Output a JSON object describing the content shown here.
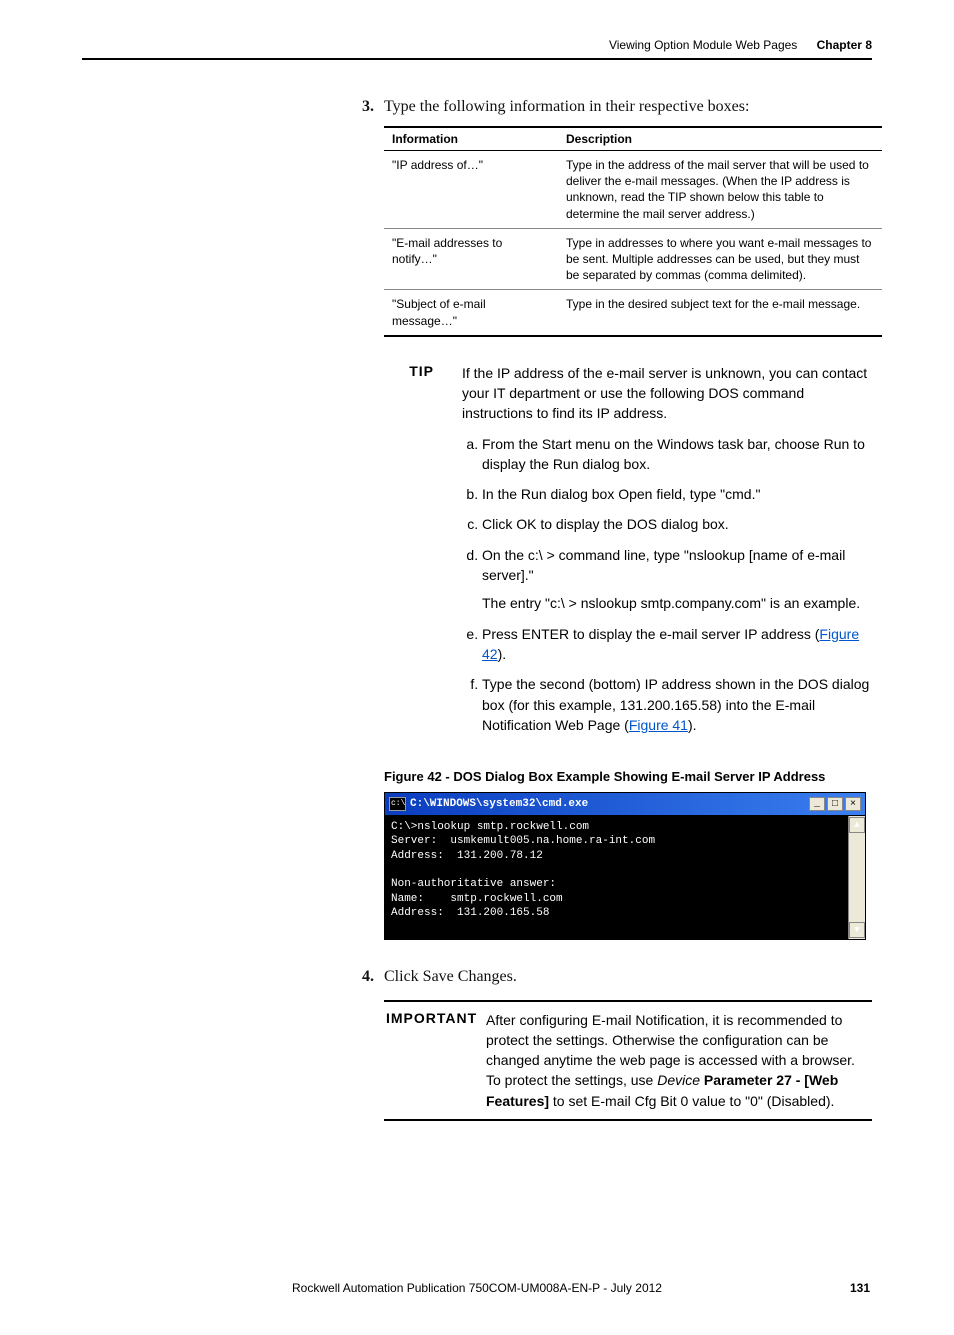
{
  "header": {
    "section": "Viewing Option Module Web Pages",
    "chapter": "Chapter 8"
  },
  "step3": {
    "num": "3.",
    "text": "Type the following information in their respective boxes:"
  },
  "table": {
    "h1": "Information",
    "h2": "Description",
    "r1c1": "\"IP address of…\"",
    "r1c2": "Type in the address of the mail server that will be used to deliver the e-mail messages. (When the IP address is unknown, read the TIP shown below this table to determine the mail server address.)",
    "r2c1": "\"E-mail addresses to notify…\"",
    "r2c2": "Type in addresses to where you want e-mail messages to be sent. Multiple addresses can be used, but they must be separated by commas (comma delimited).",
    "r3c1": "\"Subject of e-mail message…\"",
    "r3c2": "Type in the desired subject text for the e-mail message."
  },
  "tip": {
    "label": "TIP",
    "intro": "If the IP address of the e-mail server is unknown, you can contact your IT department or use the following DOS command instructions to find its IP address.",
    "a": "From the Start menu on the Windows task bar, choose Run to display the Run dialog box.",
    "b": "In the Run dialog box Open field, type \"cmd.\"",
    "c": "Click OK to display the DOS dialog box.",
    "d": "On the c:\\ > command line, type \"nslookup [name of e-mail server].\"",
    "d_sub": "The entry \"c:\\ > nslookup smtp.company.com\" is an example.",
    "e_pre": "Press ENTER to display the e-mail server IP address (",
    "e_link": "Figure 42",
    "e_post": ").",
    "f_pre": "Type the second (bottom) IP address shown in the DOS dialog box (for this example, 131.200.165.58) into the E-mail Notification Web Page (",
    "f_link": "Figure 41",
    "f_post": ")."
  },
  "figure": {
    "caption": "Figure 42 - DOS Dialog Box Example Showing E-mail Server IP Address",
    "title": "C:\\WINDOWS\\system32\\cmd.exe",
    "body": "C:\\>nslookup smtp.rockwell.com\nServer:  usmkemult005.na.home.ra-int.com\nAddress:  131.200.78.12\n\nNon-authoritative answer:\nName:    smtp.rockwell.com\nAddress:  131.200.165.58\n\n"
  },
  "step4": {
    "num": "4.",
    "text": "Click Save Changes."
  },
  "important": {
    "label": "IMPORTANT",
    "pre": "After configuring E-mail Notification, it is recommended to protect the settings. Otherwise the configuration can be changed anytime the web page is accessed with a browser. To protect the settings, use ",
    "italic": "Device ",
    "bold": "Parameter 27 - [Web Features]",
    "post": " to set E-mail Cfg Bit 0 value to \"0\" (Disabled)."
  },
  "footer": {
    "pub": "Rockwell Automation Publication 750COM-UM008A-EN-P - July 2012",
    "page": "131"
  }
}
